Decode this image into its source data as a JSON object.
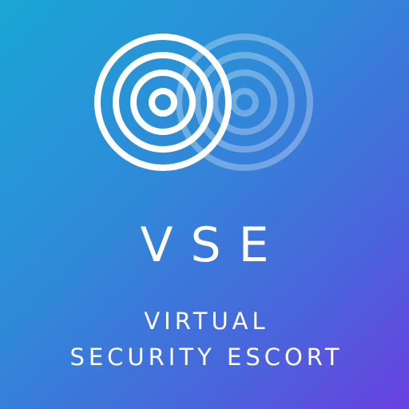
{
  "logo": {
    "icon": "concentric-rings-icon",
    "color": "#ffffff"
  },
  "abbreviation": "VSE",
  "tagline": {
    "line1": "VIRTUAL",
    "line2": "SECURITY ESCORT"
  },
  "colors": {
    "gradient_start": "#1aa6d6",
    "gradient_end": "#6a40e0"
  }
}
